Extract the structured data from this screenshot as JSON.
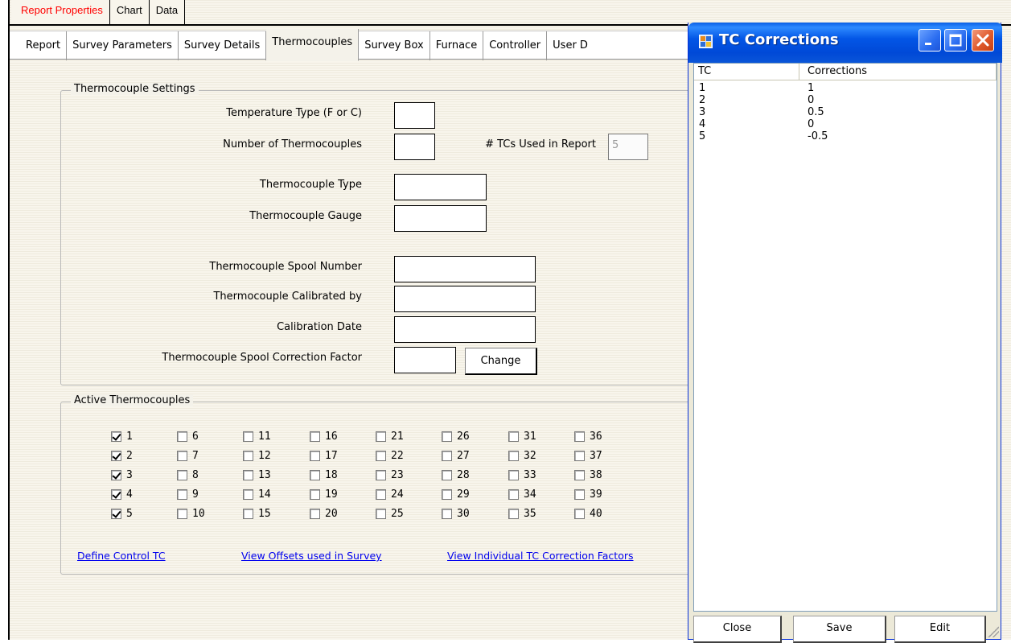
{
  "top_tabs": [
    "Report Properties",
    "Chart",
    "Data"
  ],
  "sub_tabs": [
    "Report",
    "Survey Parameters",
    "Survey Details",
    "Thermocouples",
    "Survey Box",
    "Furnace",
    "Controller",
    "User D"
  ],
  "settings": {
    "title": "Thermocouple Settings",
    "temperature_type_label": "Temperature Type (F or C)",
    "temperature_type_value": "",
    "num_tc_label": "Number of Thermocouples",
    "num_tc_value": "",
    "tcs_used_label": "# TCs Used in Report",
    "tcs_used_value": "5",
    "tc_type_label": "Thermocouple Type",
    "tc_gauge_label": "Thermocouple Gauge",
    "spool_number_label": "Thermocouple Spool Number",
    "calibrated_by_label": "Thermocouple Calibrated by",
    "calibration_date_label": "Calibration Date",
    "spool_correction_label": "Thermocouple Spool Correction Factor",
    "change_button": "Change"
  },
  "active": {
    "title": "Active Thermocouples",
    "columns": [
      [
        {
          "label": "1",
          "checked": true
        },
        {
          "label": "2",
          "checked": true
        },
        {
          "label": "3",
          "checked": true
        },
        {
          "label": "4",
          "checked": true
        },
        {
          "label": "5",
          "checked": true
        }
      ],
      [
        {
          "label": "6",
          "checked": false
        },
        {
          "label": "7",
          "checked": false
        },
        {
          "label": "8",
          "checked": false
        },
        {
          "label": "9",
          "checked": false
        },
        {
          "label": "10",
          "checked": false
        }
      ],
      [
        {
          "label": "11",
          "checked": false
        },
        {
          "label": "12",
          "checked": false
        },
        {
          "label": "13",
          "checked": false
        },
        {
          "label": "14",
          "checked": false
        },
        {
          "label": "15",
          "checked": false
        }
      ],
      [
        {
          "label": "16",
          "checked": false
        },
        {
          "label": "17",
          "checked": false
        },
        {
          "label": "18",
          "checked": false
        },
        {
          "label": "19",
          "checked": false
        },
        {
          "label": "20",
          "checked": false
        }
      ],
      [
        {
          "label": "21",
          "checked": false
        },
        {
          "label": "22",
          "checked": false
        },
        {
          "label": "23",
          "checked": false
        },
        {
          "label": "24",
          "checked": false
        },
        {
          "label": "25",
          "checked": false
        }
      ],
      [
        {
          "label": "26",
          "checked": false
        },
        {
          "label": "27",
          "checked": false
        },
        {
          "label": "28",
          "checked": false
        },
        {
          "label": "29",
          "checked": false
        },
        {
          "label": "30",
          "checked": false
        }
      ],
      [
        {
          "label": "31",
          "checked": false
        },
        {
          "label": "32",
          "checked": false
        },
        {
          "label": "33",
          "checked": false
        },
        {
          "label": "34",
          "checked": false
        },
        {
          "label": "35",
          "checked": false
        }
      ],
      [
        {
          "label": "36",
          "checked": false
        },
        {
          "label": "37",
          "checked": false
        },
        {
          "label": "38",
          "checked": false
        },
        {
          "label": "39",
          "checked": false
        },
        {
          "label": "40",
          "checked": false
        }
      ]
    ],
    "link_control": "Define Control TC",
    "link_offsets": "View Offsets used in Survey",
    "link_corrections": "View Individual TC Correction Factors"
  },
  "popup": {
    "title": "TC Corrections",
    "icon": "app-window-icon",
    "columns": [
      "TC",
      "Corrections"
    ],
    "rows": [
      [
        "1",
        "1"
      ],
      [
        "2",
        "0"
      ],
      [
        "3",
        "0.5"
      ],
      [
        "4",
        "0"
      ],
      [
        "5",
        "-0.5"
      ]
    ],
    "close_button": "Close",
    "save_button": "Save",
    "edit_button": "Edit"
  },
  "colors": {
    "active_tab_text": "#ff0000",
    "link": "#0000ee",
    "titlebar": "#0049d7"
  }
}
